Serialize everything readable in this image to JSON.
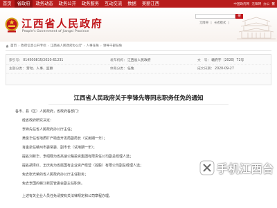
{
  "topnav": {
    "items": [
      "首页",
      "省政府",
      "政务动态",
      "政务公开",
      "政务服务",
      "互动交流",
      "数据",
      "美丽江西"
    ],
    "active_index": 1,
    "right": {
      "mobile": "中国政府网",
      "accessible": "无障碍",
      "mail": "办公",
      "traditional": "繁"
    }
  },
  "header": {
    "title": "江西省人民政府",
    "subtitle": "People's Government of Jiangxi Province",
    "search_placeholder": "",
    "search_btn": "搜",
    "links": [
      "无障碍",
      "|",
      "长者模式",
      "|"
    ]
  },
  "breadcrumb": [
    "首页",
    "政府信息公开专栏",
    "江西省人民政府办公厅",
    "人事任免",
    "领导干部任免"
  ],
  "meta": {
    "index_label": "索引号：",
    "index_value": "014500815/2020-61231",
    "publisher_label": "发布机构：",
    "publisher_value": "江西省人民政府",
    "doc_no_label": "文　号：",
    "doc_no_value": "赣府字〔2020〕72号",
    "topic_label": "主题分类：",
    "topic_value": "劳动、人事、监察",
    "type_label": "体裁分类：",
    "type_value": "任免",
    "date_label": "成文日期：",
    "date_value": "2020-09-27"
  },
  "article": {
    "title": "江西省人民政府关于李锋先等同志职务任免的通知",
    "paragraphs": [
      "各市、县（区）人民政府，省政府各部门：",
      "经省政府研究决定：",
      "李锋先任省人民政府办公厅主任；",
      "吴俊华任省地质矿产勘查开发局副局长（试用期一年）；",
      "肖金泉任赣州市委常委、副市长（试用期一年）；",
      "提名刘新华、李绍翔为省高速公路投资集团有限责任公司副总经理人选；",
      "提名胡泽红、王庆宪为省属国有企业资产经营（控股）有限公司副总经理人选；",
      "免去张光荣的省人民政府办公厅主任职务；",
      "免去李国的赣江新区管委会副主任职务。",
      "上述有关企业人员任免请按有关法律规定和公司章程办理。"
    ]
  },
  "watermark": {
    "text": "手机江西台"
  },
  "colors": {
    "brand_red": "#c0161b",
    "nav_red": "#b81c1c"
  }
}
